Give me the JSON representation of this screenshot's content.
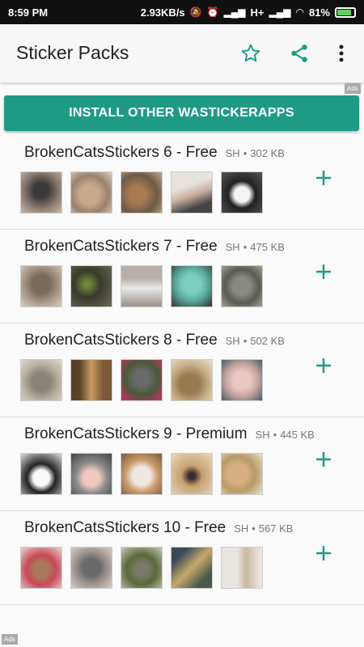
{
  "status": {
    "time": "8:59 PM",
    "speed": "2.93KB/s",
    "network": "H+",
    "battery": "81%"
  },
  "app_bar": {
    "title": "Sticker Packs",
    "icons": [
      "star-outline-icon",
      "share-icon",
      "more-vert-icon"
    ]
  },
  "ads": {
    "top": "Ads",
    "bottom": "Ads"
  },
  "install_button": {
    "label": "INSTALL OTHER WASTICKERAPPS"
  },
  "colors": {
    "accent": "#1f9a86",
    "status_bar": "#111111",
    "app_bar": "#f7f7f7"
  },
  "packs": [
    {
      "name": "BrokenCatsStickers 6 - Free",
      "publisher": "SH",
      "size": "302 KB"
    },
    {
      "name": "BrokenCatsStickers 7 - Free",
      "publisher": "SH",
      "size": "475 KB"
    },
    {
      "name": "BrokenCatsStickers 8 - Free",
      "publisher": "SH",
      "size": "502 KB"
    },
    {
      "name": "BrokenCatsStickers 9 - Premium",
      "publisher": "SH",
      "size": "445 KB"
    },
    {
      "name": "BrokenCatsStickers 10 - Free",
      "publisher": "SH",
      "size": "567 KB"
    }
  ]
}
